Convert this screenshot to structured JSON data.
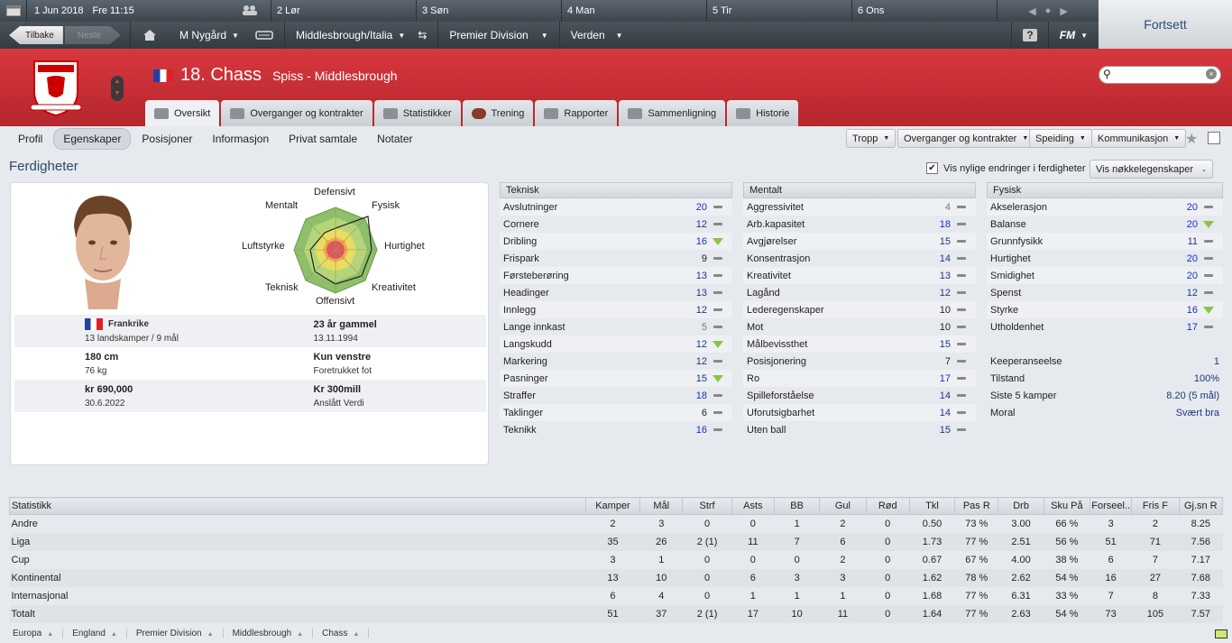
{
  "topbar": {
    "date": "1 Jun 2018",
    "day_time": "Fre  11:15",
    "days": [
      "2 Lør",
      "3 Søn",
      "4 Man",
      "5 Tir",
      "6 Ons"
    ]
  },
  "nav": {
    "back": "Tilbake",
    "forward": "Neste",
    "manager": "M Nygård",
    "club": "Middlesbrough/Italia",
    "competition": "Premier Division",
    "world": "Verden",
    "help": "?",
    "fm": "FM",
    "continue": "Fortsett"
  },
  "player": {
    "number_name": "18. Chass",
    "position_club": "Spiss - Middlesbrough"
  },
  "tabs": [
    "Oversikt",
    "Overganger og kontrakter",
    "Statistikker",
    "Trening",
    "Rapporter",
    "Sammenligning",
    "Historie"
  ],
  "subnav": [
    "Profil",
    "Egenskaper",
    "Posisjoner",
    "Informasjon",
    "Privat samtale",
    "Notater"
  ],
  "dropdowns": [
    "Tropp",
    "Overganger og kontrakter",
    "Speiding",
    "Kommunikasjon"
  ],
  "section_title": "Ferdigheter",
  "toggle": {
    "label": "Vis nylige endringer i ferdigheter",
    "key_attr": "Vis nøkkelegenskaper"
  },
  "radar_labels": {
    "top": "Defensivt",
    "tl": "Mentalt",
    "tr": "Fysisk",
    "left": "Luftstyrke",
    "right": "Hurtighet",
    "bl": "Teknisk",
    "br": "Kreativitet",
    "bottom": "Offensivt"
  },
  "info": {
    "nation": "Frankrike",
    "caps": "13 landskamper / 9 mål",
    "age": "23 år gammel",
    "dob": "13.11.1994",
    "height": "180 cm",
    "weight": "76 kg",
    "foot": "Kun venstre",
    "foot_label": "Foretrukket fot",
    "wage": "kr 690,000",
    "contract": "30.6.2022",
    "value": "Kr 300mill",
    "value_label": "Anslått Verdi"
  },
  "technical": {
    "title": "Teknisk",
    "rows": [
      {
        "n": "Avslutninger",
        "v": "20",
        "c": "hi",
        "t": "dash"
      },
      {
        "n": "Cornere",
        "v": "12",
        "c": "mid",
        "t": "dash"
      },
      {
        "n": "Dribling",
        "v": "16",
        "c": "hi",
        "t": "up"
      },
      {
        "n": "Frispark",
        "v": "9",
        "c": "n",
        "t": "dash"
      },
      {
        "n": "Førsteberøring",
        "v": "13",
        "c": "mid",
        "t": "dash"
      },
      {
        "n": "Headinger",
        "v": "13",
        "c": "mid",
        "t": "dash"
      },
      {
        "n": "Innlegg",
        "v": "12",
        "c": "mid",
        "t": "dash"
      },
      {
        "n": "Lange innkast",
        "v": "5",
        "c": "lo",
        "t": "dash"
      },
      {
        "n": "Langskudd",
        "v": "12",
        "c": "mid",
        "t": "up"
      },
      {
        "n": "Markering",
        "v": "12",
        "c": "mid",
        "t": "dash"
      },
      {
        "n": "Pasninger",
        "v": "15",
        "c": "mid",
        "t": "up"
      },
      {
        "n": "Straffer",
        "v": "18",
        "c": "hi",
        "t": "dash"
      },
      {
        "n": "Taklinger",
        "v": "6",
        "c": "n",
        "t": "dash"
      },
      {
        "n": "Teknikk",
        "v": "16",
        "c": "hi",
        "t": "dash"
      }
    ]
  },
  "mental": {
    "title": "Mentalt",
    "rows": [
      {
        "n": "Aggressivitet",
        "v": "4",
        "c": "lo",
        "t": "dash"
      },
      {
        "n": "Arb.kapasitet",
        "v": "18",
        "c": "hi",
        "t": "dash"
      },
      {
        "n": "Avgjørelser",
        "v": "15",
        "c": "mid",
        "t": "dash"
      },
      {
        "n": "Konsentrasjon",
        "v": "14",
        "c": "mid",
        "t": "dash"
      },
      {
        "n": "Kreativitet",
        "v": "13",
        "c": "mid",
        "t": "dash"
      },
      {
        "n": "Lagånd",
        "v": "12",
        "c": "mid",
        "t": "dash"
      },
      {
        "n": "Lederegenskaper",
        "v": "10",
        "c": "n",
        "t": "dash"
      },
      {
        "n": "Mot",
        "v": "10",
        "c": "n",
        "t": "dash"
      },
      {
        "n": "Målbevissthet",
        "v": "15",
        "c": "mid",
        "t": "dash"
      },
      {
        "n": "Posisjonering",
        "v": "7",
        "c": "n",
        "t": "dash"
      },
      {
        "n": "Ro",
        "v": "17",
        "c": "hi",
        "t": "dash"
      },
      {
        "n": "Spilleforståelse",
        "v": "14",
        "c": "mid",
        "t": "dash"
      },
      {
        "n": "Uforutsigbarhet",
        "v": "14",
        "c": "mid",
        "t": "dash"
      },
      {
        "n": "Uten ball",
        "v": "15",
        "c": "mid",
        "t": "dash"
      }
    ]
  },
  "physical": {
    "title": "Fysisk",
    "rows": [
      {
        "n": "Akselerasjon",
        "v": "20",
        "c": "hi",
        "t": "dash"
      },
      {
        "n": "Balanse",
        "v": "20",
        "c": "hi",
        "t": "up"
      },
      {
        "n": "Grunnfysikk",
        "v": "11",
        "c": "mid",
        "t": "dash"
      },
      {
        "n": "Hurtighet",
        "v": "20",
        "c": "hi",
        "t": "dash"
      },
      {
        "n": "Smidighet",
        "v": "20",
        "c": "hi",
        "t": "dash"
      },
      {
        "n": "Spenst",
        "v": "12",
        "c": "mid",
        "t": "dash"
      },
      {
        "n": "Styrke",
        "v": "16",
        "c": "hi",
        "t": "up"
      },
      {
        "n": "Utholdenhet",
        "v": "17",
        "c": "hi",
        "t": "dash"
      }
    ]
  },
  "extra": [
    {
      "n": "Keeperanseelse",
      "v": "1"
    },
    {
      "n": "Tilstand",
      "v": "100%"
    },
    {
      "n": "Siste 5 kamper",
      "v": "8.20 (5 mål)"
    },
    {
      "n": "Moral",
      "v": "Svært bra"
    }
  ],
  "stats": {
    "headers": [
      "Statistikk",
      "Kamper",
      "Mål",
      "Strf",
      "Asts",
      "BB",
      "Gul",
      "Rød",
      "Tkl",
      "Pas R",
      "Drb",
      "Sku På",
      "Forseel..",
      "Fris F",
      "Gj.sn R"
    ],
    "rows": [
      [
        "Andre",
        "2",
        "3",
        "0",
        "0",
        "1",
        "2",
        "0",
        "0.50",
        "73 %",
        "3.00",
        "66 %",
        "3",
        "2",
        "8.25"
      ],
      [
        "Liga",
        "35",
        "26",
        "2 (1)",
        "11",
        "7",
        "6",
        "0",
        "1.73",
        "77 %",
        "2.51",
        "56 %",
        "51",
        "71",
        "7.56"
      ],
      [
        "Cup",
        "3",
        "1",
        "0",
        "0",
        "0",
        "2",
        "0",
        "0.67",
        "67 %",
        "4.00",
        "38 %",
        "6",
        "7",
        "7.17"
      ],
      [
        "Kontinental",
        "13",
        "10",
        "0",
        "6",
        "3",
        "3",
        "0",
        "1.62",
        "78 %",
        "2.62",
        "54 %",
        "16",
        "27",
        "7.68"
      ],
      [
        "Internasjonal",
        "6",
        "4",
        "0",
        "1",
        "1",
        "1",
        "0",
        "1.68",
        "77 %",
        "6.31",
        "33 %",
        "7",
        "8",
        "7.33"
      ],
      [
        "Totalt",
        "51",
        "37",
        "2 (1)",
        "17",
        "10",
        "11",
        "0",
        "1.64",
        "77 %",
        "2.63",
        "54 %",
        "73",
        "105",
        "7.57"
      ]
    ]
  },
  "breadcrumb": [
    "Europa",
    "England",
    "Premier Division",
    "Middlesbrough",
    "Chass"
  ]
}
